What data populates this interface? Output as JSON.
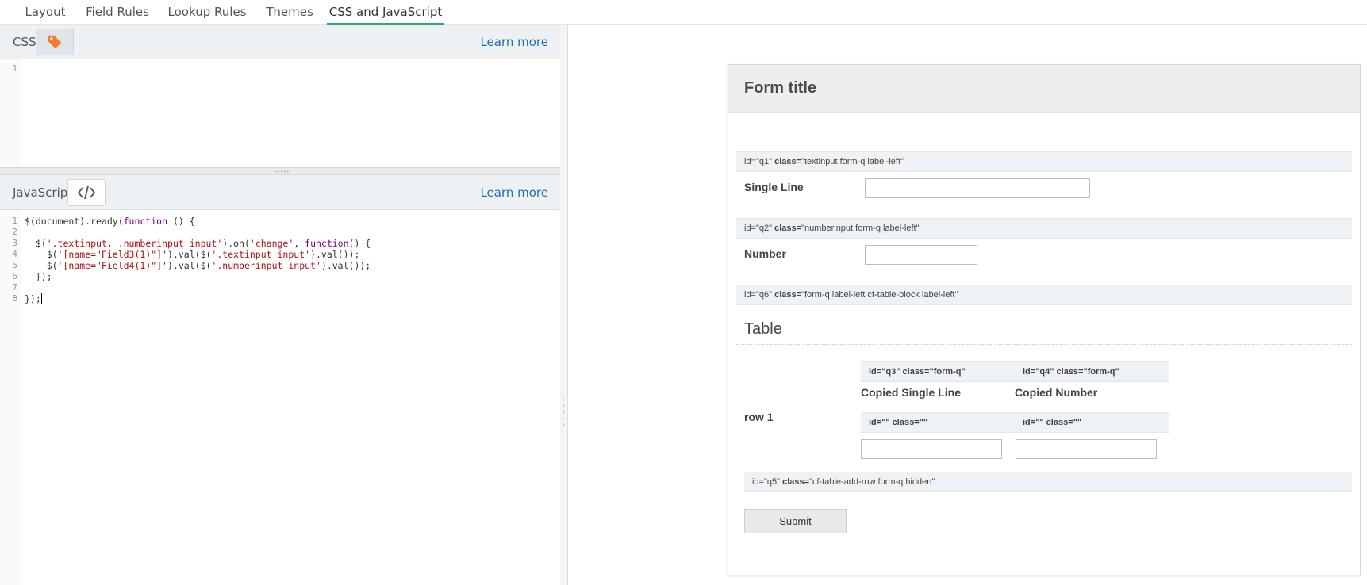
{
  "tabs": [
    {
      "label": "Layout",
      "active": false
    },
    {
      "label": "Field Rules",
      "active": false
    },
    {
      "label": "Lookup Rules",
      "active": false
    },
    {
      "label": "Themes",
      "active": false
    },
    {
      "label": "CSS and JavaScript",
      "active": true
    }
  ],
  "css_pane": {
    "title": "CSS",
    "button_icon": "tag-icon",
    "learn_more": "Learn more",
    "line_numbers": [
      "1"
    ]
  },
  "js_pane": {
    "title": "JavaScript",
    "button_icon": "code-icon",
    "learn_more": "Learn more",
    "line_numbers": [
      "1",
      "2",
      "3",
      "4",
      "5",
      "6",
      "7",
      "8"
    ]
  },
  "colors": {
    "active_tab_underline": "#2aa876",
    "link": "#1f6fb3",
    "tag_icon": "#f07d32",
    "keyword": "#770088",
    "string": "#aa1111"
  },
  "form": {
    "title": "Form title",
    "q1": {
      "id_text": "id=\"q1\"",
      "class_label": "class=",
      "class_text": "\"textinput form-q label-left\"",
      "label": "Single Line"
    },
    "q2": {
      "id_text": "id=\"q2\"",
      "class_label": "class=",
      "class_text": "\"numberinput form-q label-left\"",
      "label": "Number"
    },
    "q6": {
      "id_text": "id=\"q6\"",
      "class_label": "class=",
      "class_text": "\"form-q label-left cf-table-block label-left\""
    },
    "table_title": "Table",
    "q3": {
      "id_text": "id=\"q3\" class=\"form-q\"",
      "label": "Copied Single Line"
    },
    "q4": {
      "id_text": "id=\"q4\" class=\"form-q\"",
      "label": "Copied Number"
    },
    "row_label": "row 1",
    "cell1": {
      "id_text": "id=\"\" class=\"\""
    },
    "cell2": {
      "id_text": "id=\"\" class=\"\""
    },
    "q5": {
      "id_text": "id=\"q5\"",
      "class_label": "class=",
      "class_text": "\"cf-table-add-row form-q hidden\""
    },
    "submit": "Submit"
  }
}
